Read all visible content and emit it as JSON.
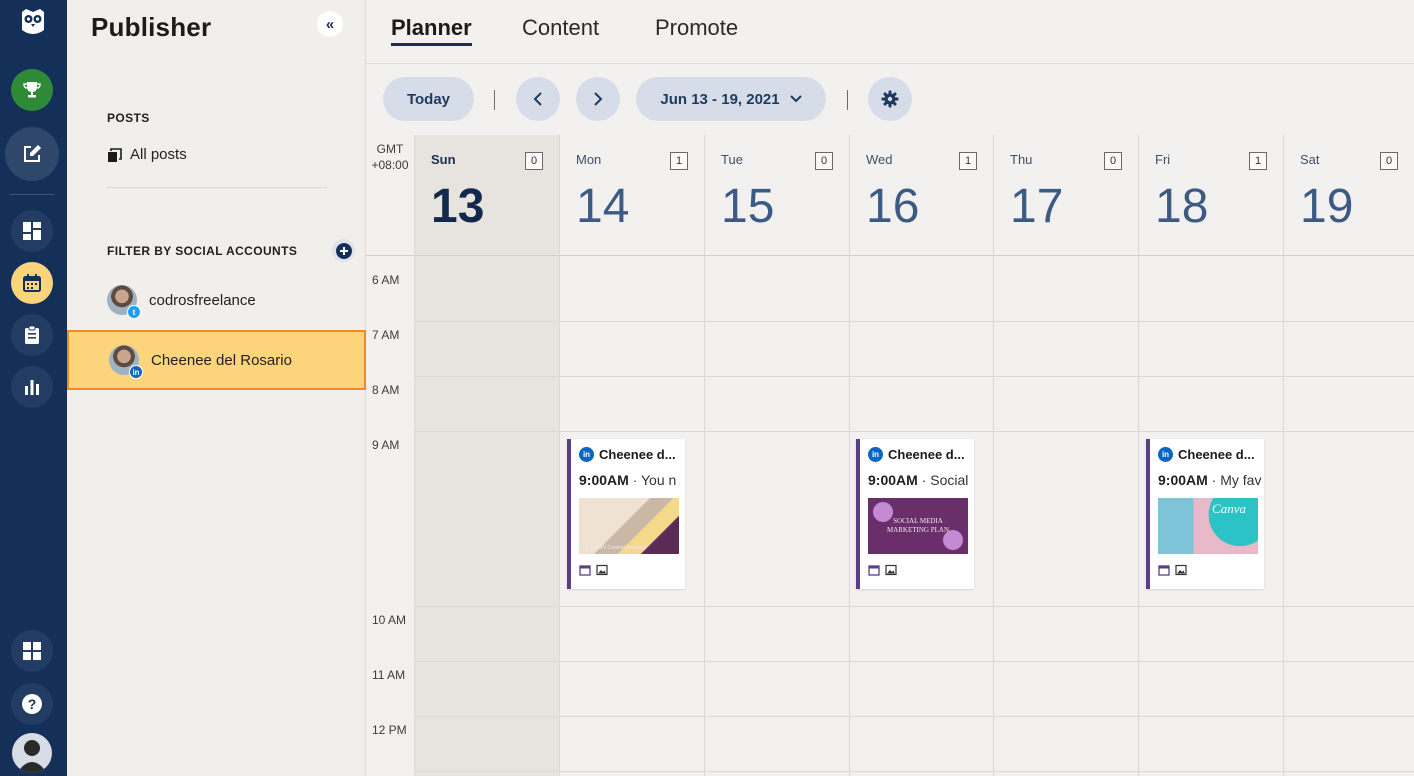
{
  "publisher": {
    "title": "Publisher",
    "collapse_label": "«",
    "posts_section": "POSTS",
    "all_posts": "All posts",
    "filter_section": "FILTER BY SOCIAL ACCOUNTS",
    "accounts": [
      {
        "name": "codrosfreelance",
        "network": "twitter",
        "badge": "t"
      },
      {
        "name": "Cheenee del Rosario",
        "network": "linkedin",
        "badge": "in"
      }
    ]
  },
  "tabs": [
    "Planner",
    "Content",
    "Promote"
  ],
  "toolbar": {
    "today_label": "Today",
    "date_range": "Jun 13 - 19, 2021"
  },
  "calendar": {
    "timezone_line1": "GMT",
    "timezone_line2": "+08:00",
    "days": [
      {
        "name": "Sun",
        "num": "13",
        "count": "0"
      },
      {
        "name": "Mon",
        "num": "14",
        "count": "1"
      },
      {
        "name": "Tue",
        "num": "15",
        "count": "0"
      },
      {
        "name": "Wed",
        "num": "16",
        "count": "1"
      },
      {
        "name": "Thu",
        "num": "17",
        "count": "0"
      },
      {
        "name": "Fri",
        "num": "18",
        "count": "1"
      },
      {
        "name": "Sat",
        "num": "19",
        "count": "0"
      }
    ],
    "hours": [
      "6 AM",
      "7 AM",
      "8 AM",
      "9 AM",
      "10 AM",
      "11 AM",
      "12 PM"
    ],
    "posts": [
      {
        "account": "Cheenee d...",
        "time": "9:00AM",
        "snippet": " · You n",
        "image_text": "LINKEDIN Content Assistant"
      },
      {
        "account": "Cheenee d...",
        "time": "9:00AM",
        "snippet": " · Social",
        "image_text": "SOCIAL MEDIA MARKETING PLAN"
      },
      {
        "account": "Cheenee d...",
        "time": "9:00AM",
        "snippet": " · My fav",
        "image_text": "Canva"
      }
    ]
  },
  "colors": {
    "rail": "#143059",
    "accent": "#143059",
    "selection": "#fbd47c",
    "selection_border": "#f08a24",
    "post_bar": "#5b3f86"
  },
  "icons": [
    "hootsuite-owl-icon",
    "trophy-icon",
    "compose-icon",
    "dashboard-icon",
    "calendar-icon",
    "clipboard-icon",
    "analytics-icon",
    "apps-icon",
    "help-icon",
    "profile-icon",
    "settings-icon",
    "chevron-left-icon",
    "chevron-right-icon",
    "chevron-down-icon",
    "add-icon",
    "linkedin-icon",
    "twitter-icon"
  ]
}
